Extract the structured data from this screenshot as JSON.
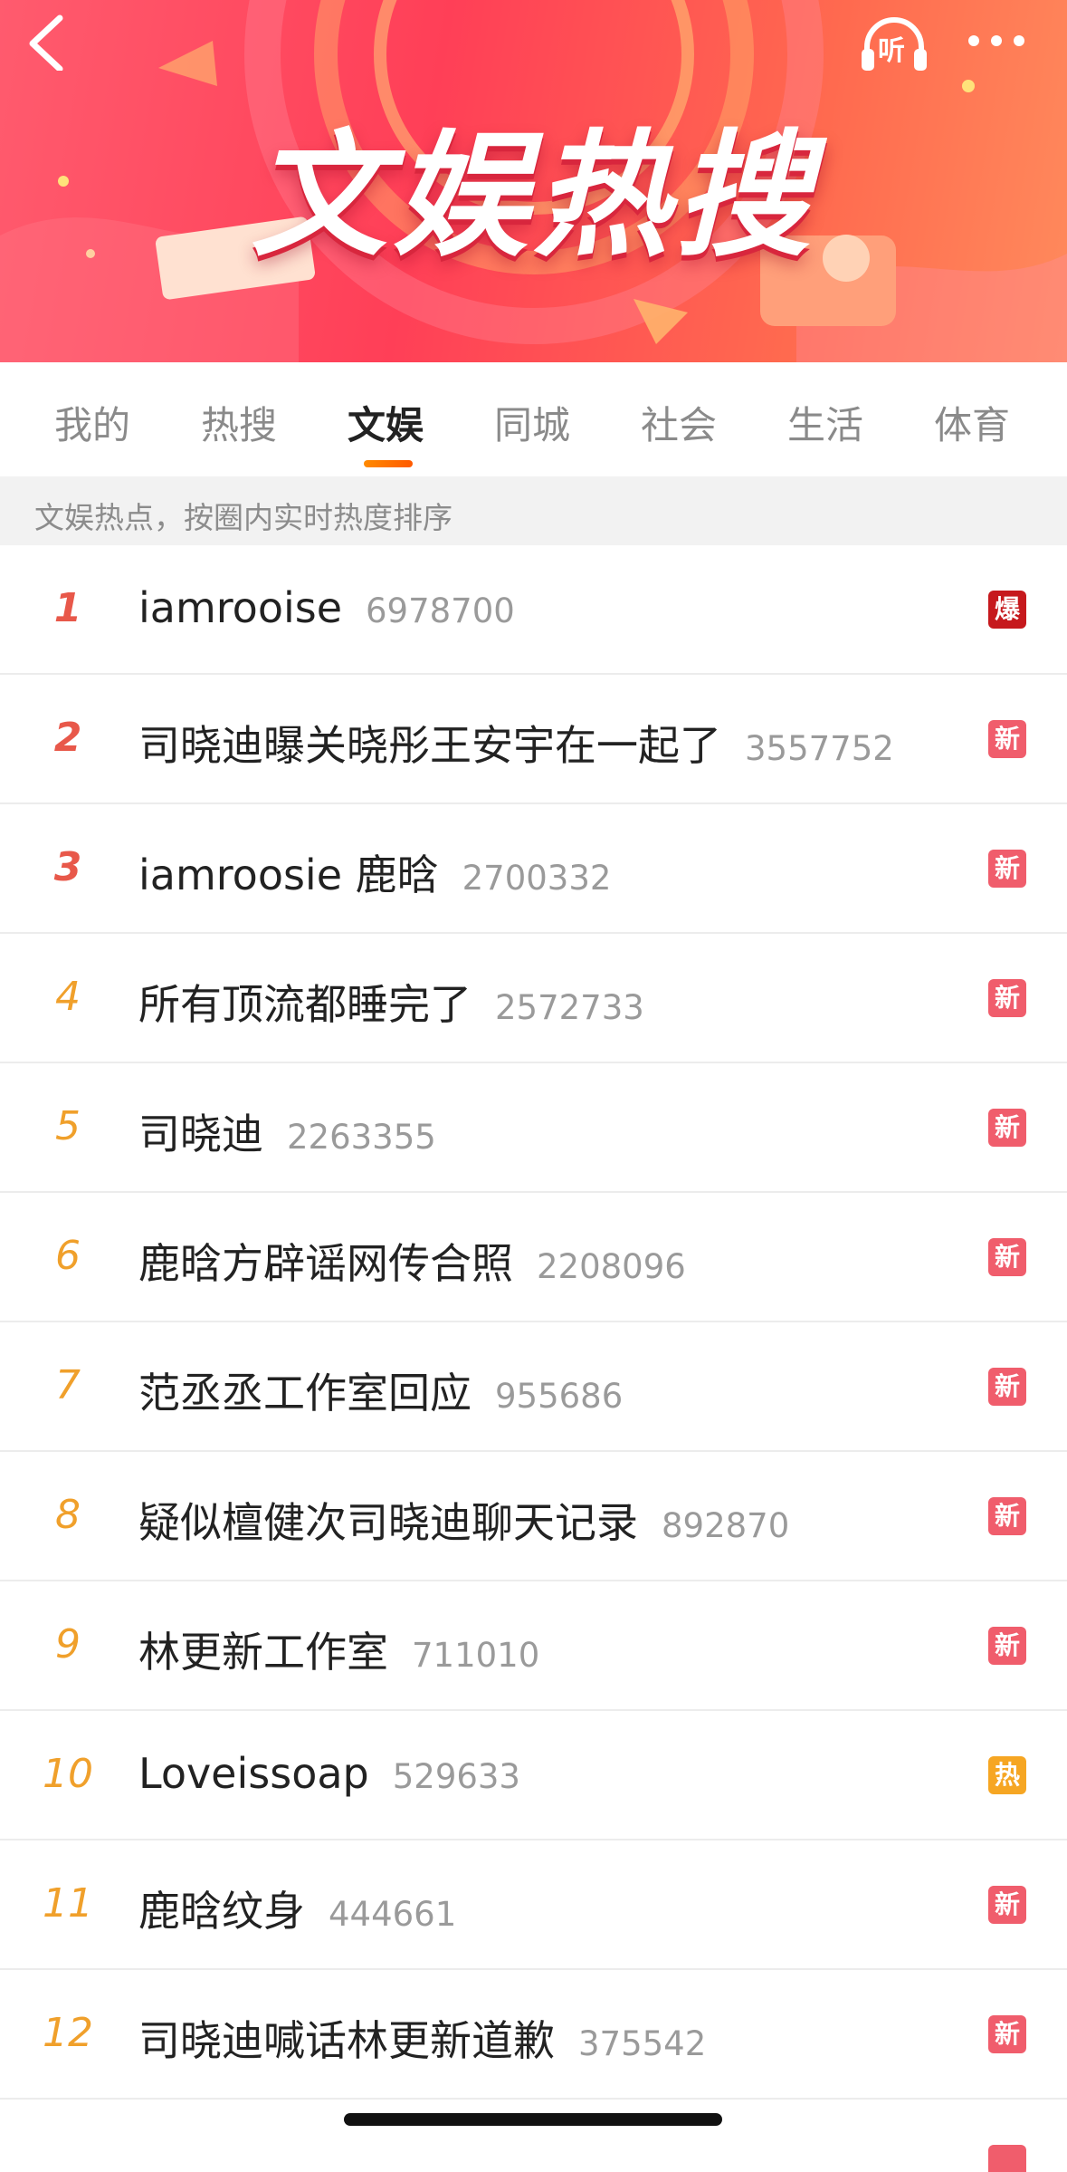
{
  "header": {
    "title": "文娱热搜",
    "audio_label": "听"
  },
  "tabs": [
    {
      "label": "我的",
      "active": false
    },
    {
      "label": "热搜",
      "active": false
    },
    {
      "label": "文娱",
      "active": true
    },
    {
      "label": "同城",
      "active": false
    },
    {
      "label": "社会",
      "active": false
    },
    {
      "label": "生活",
      "active": false
    },
    {
      "label": "体育",
      "active": false
    }
  ],
  "notice": "文娱热点，按圈内实时热度排序",
  "badge_colors": {
    "爆": "#c6191d",
    "新": "#f05d6c",
    "热": "#f6a623"
  },
  "list": [
    {
      "rank": "1",
      "title": "iamrooise",
      "count": "6978700",
      "badge": "爆"
    },
    {
      "rank": "2",
      "title": "司晓迪曝关晓彤王安宇在一起了",
      "count": "3557752",
      "badge": "新"
    },
    {
      "rank": "3",
      "title": "iamroosie 鹿晗",
      "count": "2700332",
      "badge": "新"
    },
    {
      "rank": "4",
      "title": "所有顶流都睡完了",
      "count": "2572733",
      "badge": "新"
    },
    {
      "rank": "5",
      "title": "司晓迪",
      "count": "2263355",
      "badge": "新"
    },
    {
      "rank": "6",
      "title": "鹿晗方辟谣网传合照",
      "count": "2208096",
      "badge": "新"
    },
    {
      "rank": "7",
      "title": "范丞丞工作室回应",
      "count": "955686",
      "badge": "新"
    },
    {
      "rank": "8",
      "title": "疑似檀健次司晓迪聊天记录",
      "count": "892870",
      "badge": "新"
    },
    {
      "rank": "9",
      "title": "林更新工作室",
      "count": "711010",
      "badge": "新"
    },
    {
      "rank": "10",
      "title": "Loveissoap",
      "count": "529633",
      "badge": "热"
    },
    {
      "rank": "11",
      "title": "鹿晗纹身",
      "count": "444661",
      "badge": "新"
    },
    {
      "rank": "12",
      "title": "司晓迪喊话林更新道歉",
      "count": "375542",
      "badge": "新"
    }
  ]
}
